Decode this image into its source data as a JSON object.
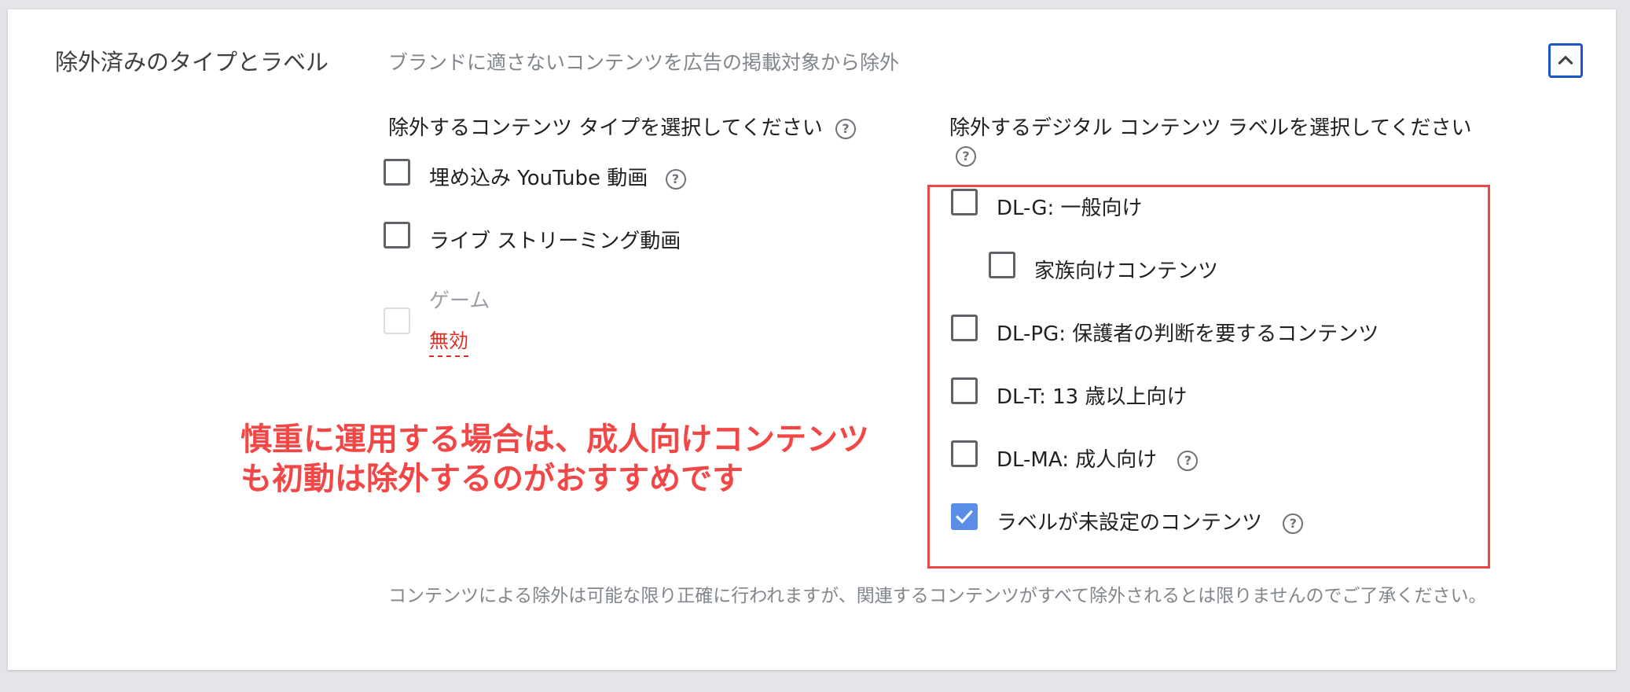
{
  "section": {
    "title": "除外済みのタイプとラベル",
    "description": "ブランドに適さないコンテンツを広告の掲載対象から除外",
    "collapse_icon": "chevron-up-icon"
  },
  "content_types": {
    "heading": "除外するコンテンツ タイプを選択してください",
    "options": [
      {
        "label": "埋め込み YouTube 動画",
        "checked": false,
        "disabled": false,
        "help": true
      },
      {
        "label": "ライブ ストリーミング動画",
        "checked": false,
        "disabled": false,
        "help": false
      },
      {
        "label": "ゲーム",
        "checked": false,
        "disabled": true,
        "note": "無効"
      }
    ]
  },
  "digital_labels": {
    "heading_line1": "除外するデジタル コンテンツ ラベルを選択してください",
    "options": [
      {
        "label": "DL-G: 一般向け",
        "checked": false
      },
      {
        "label": "家族向けコンテンツ",
        "checked": false,
        "indent": true
      },
      {
        "label": "DL-PG: 保護者の判断を要するコンテンツ",
        "checked": false
      },
      {
        "label": "DL-T: 13 歳以上向け",
        "checked": false
      },
      {
        "label": "DL-MA: 成人向け",
        "checked": false,
        "help": true
      },
      {
        "label": "ラベルが未設定のコンテンツ",
        "checked": true,
        "help": true
      }
    ]
  },
  "annotation": {
    "line1": "慎重に運用する場合は、成人向けコンテンツ",
    "line2": "も初動は除外するのがおすすめです"
  },
  "footnote": "コンテンツによる除外は可能な限り正確に行われますが、関連するコンテンツがすべて除外されるとは限りませんのでご了承ください。",
  "colors": {
    "accent_blue": "#1a56c4",
    "checked_blue": "#5a8ee6",
    "annotation_red": "#f24747",
    "disabled_red": "#d93025"
  }
}
